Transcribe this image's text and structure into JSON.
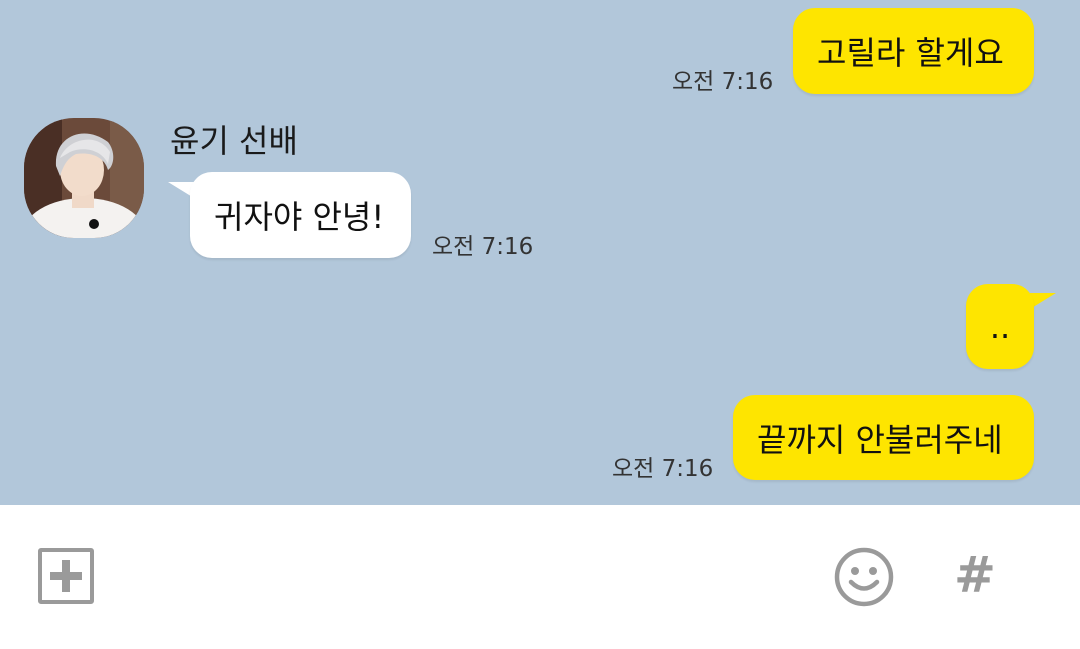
{
  "conversation": {
    "sender_name": "윤기 선배",
    "messages": [
      {
        "from": "me",
        "text": "고릴라 할게요",
        "time": "오전 7:16"
      },
      {
        "from": "other",
        "text": "귀자야 안녕!",
        "time": "오전 7:16"
      },
      {
        "from": "me",
        "text": "..",
        "time": ""
      },
      {
        "from": "me",
        "text": "끝까지 안불러주네",
        "time": "오전 7:16"
      }
    ]
  },
  "input_bar": {
    "plus_icon": "plus-square-icon",
    "emoji_icon": "smiley-icon",
    "hash_label": "#"
  },
  "colors": {
    "chat_background": "#b2c7da",
    "my_bubble": "#fee500",
    "other_bubble": "#ffffff",
    "icon_gray": "#9a9a9a"
  }
}
